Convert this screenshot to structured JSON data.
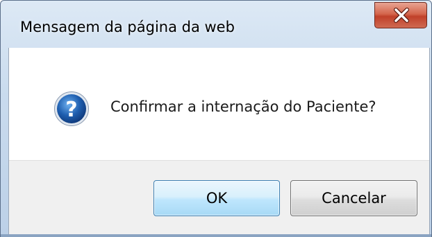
{
  "window": {
    "title": "Mensagem da página da web",
    "close_icon": "close-icon"
  },
  "dialog": {
    "icon": "question-icon",
    "message": "Confirmar a internação do Paciente?"
  },
  "buttons": {
    "ok_label": "OK",
    "cancel_label": "Cancelar"
  },
  "colors": {
    "close_button": "#c0412a",
    "ok_border": "#3c7fb1",
    "question_icon": "#1f5fb0"
  }
}
